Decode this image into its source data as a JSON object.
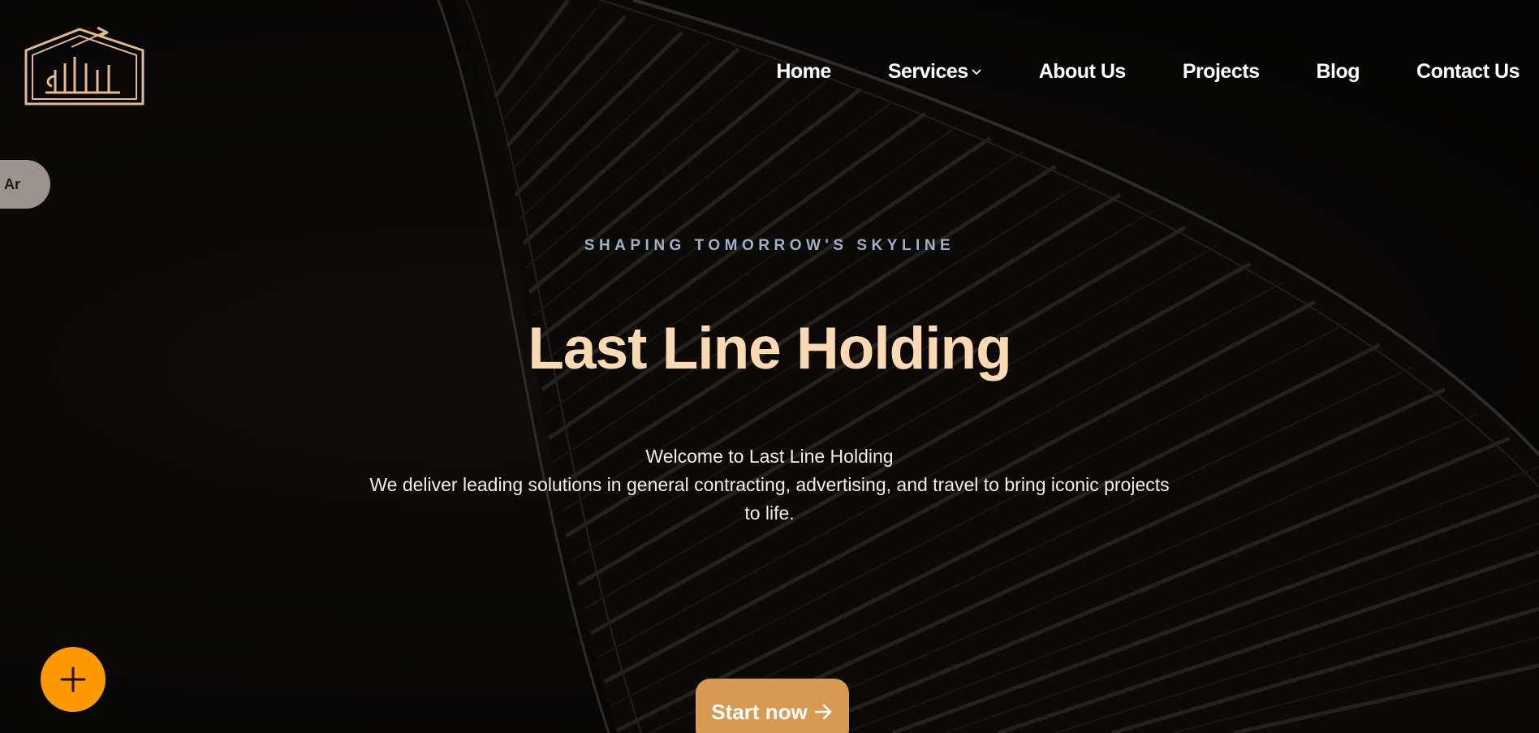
{
  "nav": {
    "items": [
      {
        "label": "Home"
      },
      {
        "label": "Services",
        "has_dropdown": true
      },
      {
        "label": "About Us"
      },
      {
        "label": "Projects"
      },
      {
        "label": "Blog"
      },
      {
        "label": "Contact Us"
      }
    ]
  },
  "language_toggle": {
    "label": "Ar"
  },
  "hero": {
    "tagline": "SHAPING TOMORROW'S SKYLINE",
    "title": "Last Line Holding",
    "description_line1": "Welcome to Last Line Holding",
    "description_line2": "We deliver leading solutions in general contracting, advertising, and travel to bring iconic projects to life.",
    "cta_label": "Start now"
  },
  "icons": {
    "logo": "building-house-logo",
    "services_chevron": "chevron-down-icon",
    "cta_arrow": "arrow-right-icon",
    "fab": "plus-icon"
  },
  "colors": {
    "background": "#0b0a09",
    "title": "#fbd9b3",
    "tagline": "#9fb0c8",
    "cta": "#d89a52",
    "fab": "#ff9900",
    "logo": "#e2b98c",
    "language_pill": "#9a948c"
  }
}
